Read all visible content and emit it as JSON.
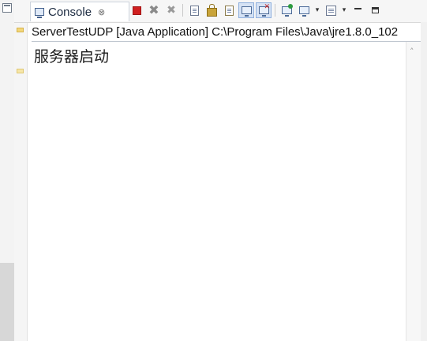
{
  "tab": {
    "title": "Console",
    "close_glyph": "⊗",
    "icon": "console-icon"
  },
  "toolbar": {
    "items": [
      {
        "name": "terminate-button",
        "icon": "stop-square-icon"
      },
      {
        "name": "remove-launch-button",
        "icon": "gray-x-icon"
      },
      {
        "name": "remove-all-terminated-button",
        "icon": "double-gray-x-icon"
      },
      {
        "name": "clear-console-button",
        "icon": "document-lines-icon"
      },
      {
        "name": "scroll-lock-button",
        "icon": "lock-icon"
      },
      {
        "name": "word-wrap-button",
        "icon": "document-wrap-icon"
      },
      {
        "name": "show-console-on-stdout-button",
        "icon": "screen-stdout-icon",
        "active": true
      },
      {
        "name": "show-console-on-stderr-button",
        "icon": "screen-stderr-icon",
        "active": true
      },
      {
        "name": "pin-console-button",
        "icon": "pin-icon"
      },
      {
        "name": "display-selected-console-button",
        "icon": "monitor-icon"
      },
      {
        "name": "open-console-button",
        "icon": "new-console-icon"
      },
      {
        "name": "minimize-button",
        "icon": "minimize-icon"
      },
      {
        "name": "maximize-button",
        "icon": "maximize-icon"
      }
    ],
    "dropdown_glyph": "▾"
  },
  "launch": {
    "text": "ServerTestUDP [Java Application] C:\\Program Files\\Java\\jre1.8.0_102"
  },
  "console": {
    "lines": [
      "服务器启动"
    ]
  },
  "scrollbar": {
    "up_glyph": "˄"
  },
  "colors": {
    "terminate_red": "#d01f1f",
    "active_toggle_bg": "#d5e2f4",
    "tab_border": "#cdd4dd"
  }
}
